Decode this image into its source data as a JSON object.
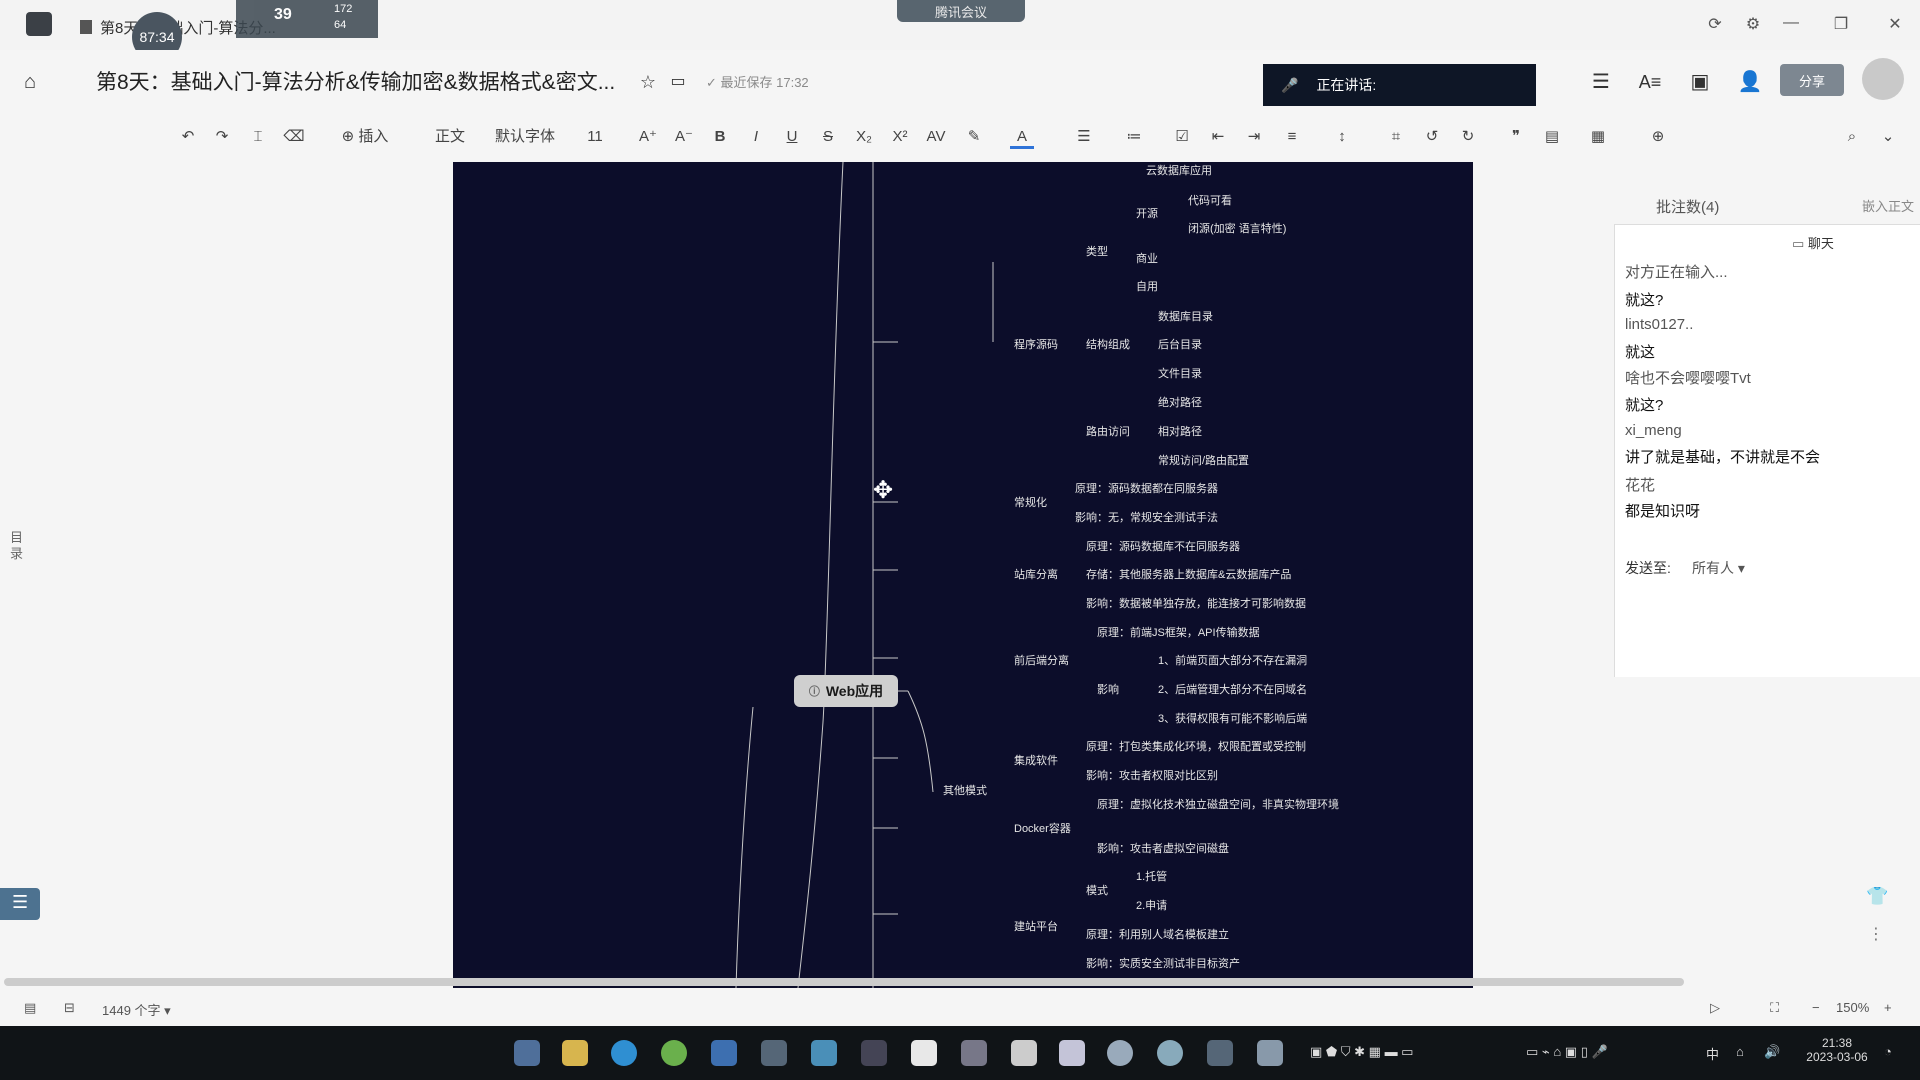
{
  "tabbar": {
    "tab_title": "第8天：基础入门-算法分...",
    "timer": "87:34",
    "badge_number": "39",
    "net_up": "172",
    "net_down": "64",
    "meeting": "腾讯会议"
  },
  "title": {
    "doc_title": "第8天：基础入门-算法分析&传输加密&数据格式&密文...",
    "saved": "最近保存 17:32",
    "speaking": "正在讲话:",
    "share": "分享"
  },
  "toolbar": {
    "insert": "插入",
    "style": "正文",
    "font": "默认字体",
    "size": "11"
  },
  "mindmap": {
    "root": "Web应用",
    "nodes": [
      {
        "text": "云数据库应用"
      },
      {
        "text": "代码可看"
      },
      {
        "text": "开源"
      },
      {
        "text": "闭源(加密 语言特性)"
      },
      {
        "text": "类型"
      },
      {
        "text": "商业"
      },
      {
        "text": "自用"
      },
      {
        "text": "数据库目录"
      },
      {
        "text": "程序源码"
      },
      {
        "text": "结构组成"
      },
      {
        "text": "后台目录"
      },
      {
        "text": "文件目录"
      },
      {
        "text": "绝对路径"
      },
      {
        "text": "路由访问"
      },
      {
        "text": "相对路径"
      },
      {
        "text": "常规访问/路由配置"
      },
      {
        "text": "原理：源码数据都在同服务器"
      },
      {
        "text": "常规化"
      },
      {
        "text": "影响：无，常规安全测试手法"
      },
      {
        "text": "原理：源码数据库不在同服务器"
      },
      {
        "text": "站库分离"
      },
      {
        "text": "存储：其他服务器上数据库&云数据库产品"
      },
      {
        "text": "影响：数据被单独存放，能连接才可影响数据"
      },
      {
        "text": "原理：前端JS框架，API传输数据"
      },
      {
        "text": "前后端分离"
      },
      {
        "text": "1、前端页面大部分不存在漏洞"
      },
      {
        "text": "影响"
      },
      {
        "text": "2、后端管理大部分不在同域名"
      },
      {
        "text": "3、获得权限有可能不影响后端"
      },
      {
        "text": "原理：打包类集成化环境，权限配置或受控制"
      },
      {
        "text": "集成软件"
      },
      {
        "text": "其他模式"
      },
      {
        "text": "影响：攻击者权限对比区别"
      },
      {
        "text": "原理：虚拟化技术独立磁盘空间，非真实物理环境"
      },
      {
        "text": "Docker容器"
      },
      {
        "text": "影响：攻击者虚拟空间磁盘"
      },
      {
        "text": "1.托管"
      },
      {
        "text": "模式"
      },
      {
        "text": "2.申请"
      },
      {
        "text": "建站平台"
      },
      {
        "text": "原理：利用别人域名模板建立"
      },
      {
        "text": "影响：实质安全测试非目标资产"
      }
    ]
  },
  "panel": {
    "comments": "批注数(4)",
    "embed": "嵌入正文",
    "chat_title": "聊天",
    "messages": [
      {
        "role": "sender",
        "text": "对方正在输入..."
      },
      {
        "role": "msg",
        "text": "就这?"
      },
      {
        "role": "sender",
        "text": "lints0127.."
      },
      {
        "role": "msg",
        "text": "就这"
      },
      {
        "role": "sender",
        "text": "啥也不会嘤嘤嘤Tvt"
      },
      {
        "role": "msg",
        "text": "就这?"
      },
      {
        "role": "sender",
        "text": "xi_meng"
      },
      {
        "role": "msg",
        "text": "讲了就是基础，不讲就是不会"
      },
      {
        "role": "sender",
        "text": "花花"
      },
      {
        "role": "msg",
        "text": "都是知识呀"
      }
    ],
    "send_to_label": "发送至:",
    "send_to_value": "所有人"
  },
  "status": {
    "word_count": "1449 个字",
    "zoom": "150%"
  },
  "sidenav": {
    "label": "目录"
  },
  "taskbar": {
    "time": "21:38",
    "date": "2023-03-06",
    "ime": "中"
  }
}
